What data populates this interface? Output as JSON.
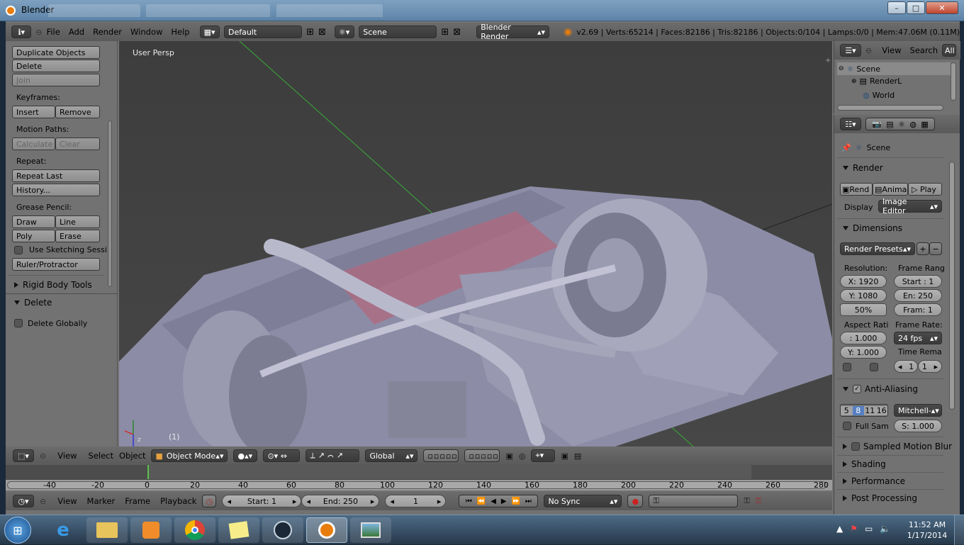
{
  "window": {
    "title": "Blender",
    "min": "–",
    "max": "□",
    "close": "✕"
  },
  "topbar": {
    "menus": [
      "File",
      "Add",
      "Render",
      "Window",
      "Help"
    ],
    "screen_layout": "Default",
    "scene": "Scene",
    "engine": "Blender Render",
    "stats": "v2.69 | Verts:65214 | Faces:82186 | Tris:82186 | Objects:0/104 | Lamps:0/0 | Mem:47.06M (0.11M)"
  },
  "toolshelf": {
    "duplicate": "Duplicate Objects",
    "delete": "Delete",
    "join": "Join",
    "keyframes_label": "Keyframes:",
    "insert": "Insert",
    "remove": "Remove",
    "motion_paths_label": "Motion Paths:",
    "calculate": "Calculate",
    "clear": "Clear",
    "repeat_label": "Repeat:",
    "repeat_last": "Repeat Last",
    "history": "History...",
    "grease_label": "Grease Pencil:",
    "draw": "Draw",
    "line": "Line",
    "poly": "Poly",
    "erase": "Erase",
    "use_sketching": "Use Sketching Sessi",
    "ruler": "Ruler/Protractor",
    "rigid_body": "Rigid Body Tools",
    "delete_panel": "Delete",
    "delete_globally": "Delete Globally"
  },
  "viewport": {
    "view_name": "User Persp",
    "frame_label": "(1)",
    "menus": [
      "View",
      "Select",
      "Object"
    ],
    "mode": "Object Mode",
    "orientation": "Global"
  },
  "timeline": {
    "ruler": [
      "-40",
      "-20",
      "0",
      "20",
      "40",
      "60",
      "80",
      "100",
      "120",
      "140",
      "160",
      "180",
      "200",
      "220",
      "240",
      "260",
      "280"
    ],
    "menus": [
      "View",
      "Marker",
      "Frame",
      "Playback"
    ],
    "start": "Start: 1",
    "end": "End: 250",
    "current": "1",
    "sync": "No Sync"
  },
  "outliner": {
    "menus": [
      "View",
      "Search",
      "All"
    ],
    "items": [
      "Scene",
      "RenderL",
      "World"
    ]
  },
  "properties": {
    "context": "Scene",
    "render_panel": "Render",
    "render_btn": "Rend",
    "anim_btn": "Anima",
    "play_btn": "Play",
    "display_label": "Display",
    "display_value": "Image Editor",
    "dimensions_panel": "Dimensions",
    "presets": "Render Presets",
    "resolution_label": "Resolution:",
    "res_x": "X: 1920",
    "res_y": "Y: 1080",
    "res_pct": "50%",
    "frame_range_label": "Frame Rang",
    "frame_start": "Start : 1",
    "frame_end": "En: 250",
    "frame_step": "Fram: 1",
    "aspect_label": "Aspect Rati",
    "aspect_x": ": 1.000",
    "aspect_y": "Y: 1.000",
    "frame_rate_label": "Frame Rate:",
    "fps": "24 fps",
    "time_remap_label": "Time Rema",
    "remap_old": "1",
    "remap_new": "1",
    "aa_panel": "Anti-Aliasing",
    "aa_samples": [
      "5",
      "8",
      "11",
      "16"
    ],
    "aa_filter": "Mitchell-",
    "full_sample": "Full Sam",
    "filter_size": "S: 1.000",
    "smb_panel": "Sampled Motion Blur",
    "shading_panel": "Shading",
    "performance_panel": "Performance",
    "post_panel": "Post Processing"
  },
  "taskbar": {
    "time": "11:52 AM",
    "date": "1/17/2014"
  }
}
